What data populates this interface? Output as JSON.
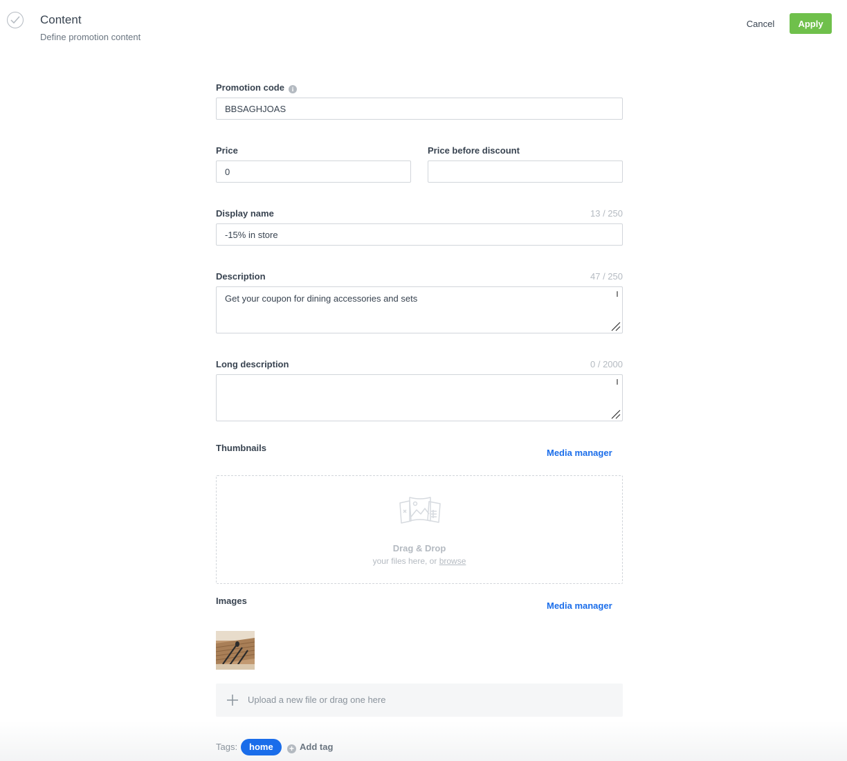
{
  "header": {
    "title": "Content",
    "subtitle": "Define promotion content",
    "cancel_label": "Cancel",
    "apply_label": "Apply"
  },
  "form": {
    "promotion_code": {
      "label": "Promotion code",
      "value": "BBSAGHJOAS"
    },
    "price": {
      "label": "Price",
      "value": "0"
    },
    "price_before_discount": {
      "label": "Price before discount",
      "value": ""
    },
    "display_name": {
      "label": "Display name",
      "counter": "13 / 250",
      "value": "-15% in store"
    },
    "description": {
      "label": "Description",
      "counter": "47 / 250",
      "value": "Get your coupon for dining accessories and sets"
    },
    "long_description": {
      "label": "Long description",
      "counter": "0 / 2000",
      "value": ""
    },
    "thumbnails": {
      "label": "Thumbnails",
      "media_manager": "Media manager",
      "drop_title": "Drag & Drop",
      "drop_sub": "your files here, or",
      "drop_browse": "browse"
    },
    "images": {
      "label": "Images",
      "media_manager": "Media manager",
      "upload_text": "Upload a new file or drag one here"
    }
  },
  "tags": {
    "label": "Tags:",
    "items": [
      "home"
    ],
    "add_label": "Add tag"
  },
  "colors": {
    "apply_green": "#6fc04b",
    "link_blue": "#1a6dea",
    "tag_blue": "#1a6dea",
    "border": "#d1d5da"
  }
}
